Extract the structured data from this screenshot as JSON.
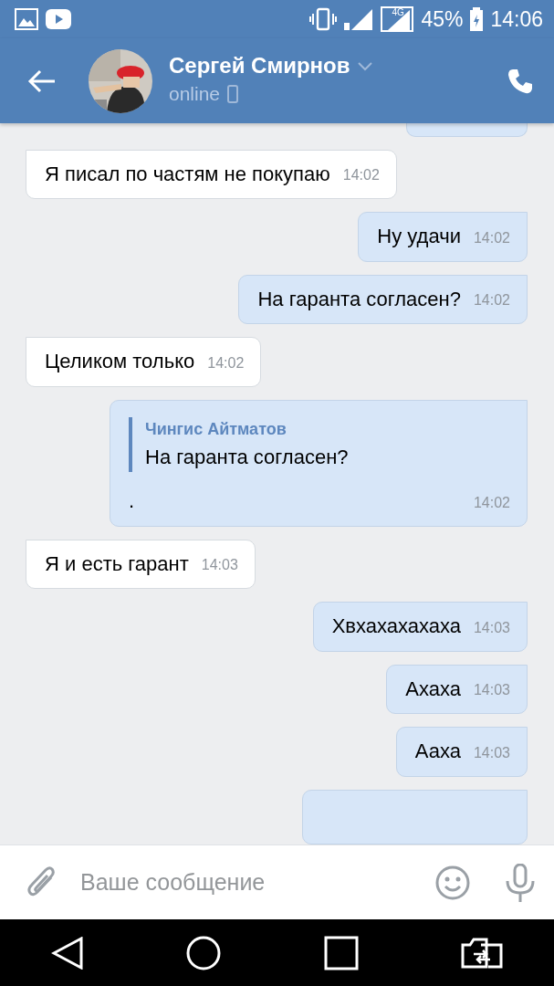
{
  "status_bar": {
    "battery": "45%",
    "time": "14:06",
    "network": "4G"
  },
  "header": {
    "name": "Сергей Смирнов",
    "status": "online"
  },
  "messages": [
    {
      "kind": "incoming",
      "text": "Я писал по частям не покупаю",
      "time": "14:02"
    },
    {
      "kind": "outgoing",
      "text": "Ну удачи",
      "time": "14:02"
    },
    {
      "kind": "outgoing",
      "text": "На гаранта согласен?",
      "time": "14:02"
    },
    {
      "kind": "incoming",
      "text": "Целиком только",
      "time": "14:02"
    },
    {
      "kind": "outgoing",
      "reply": {
        "author": "Чингис Айтматов",
        "text": "На гаранта согласен?"
      },
      "text": ".",
      "time": "14:02"
    },
    {
      "kind": "incoming",
      "text": "Я и есть гарант",
      "time": "14:03"
    },
    {
      "kind": "outgoing",
      "text": "Хвхахахахаха",
      "time": "14:03"
    },
    {
      "kind": "outgoing",
      "text": "Ахаха",
      "time": "14:03"
    },
    {
      "kind": "outgoing",
      "text": "Ааха",
      "time": "14:03"
    }
  ],
  "composer": {
    "placeholder": "Ваше сообщение"
  }
}
